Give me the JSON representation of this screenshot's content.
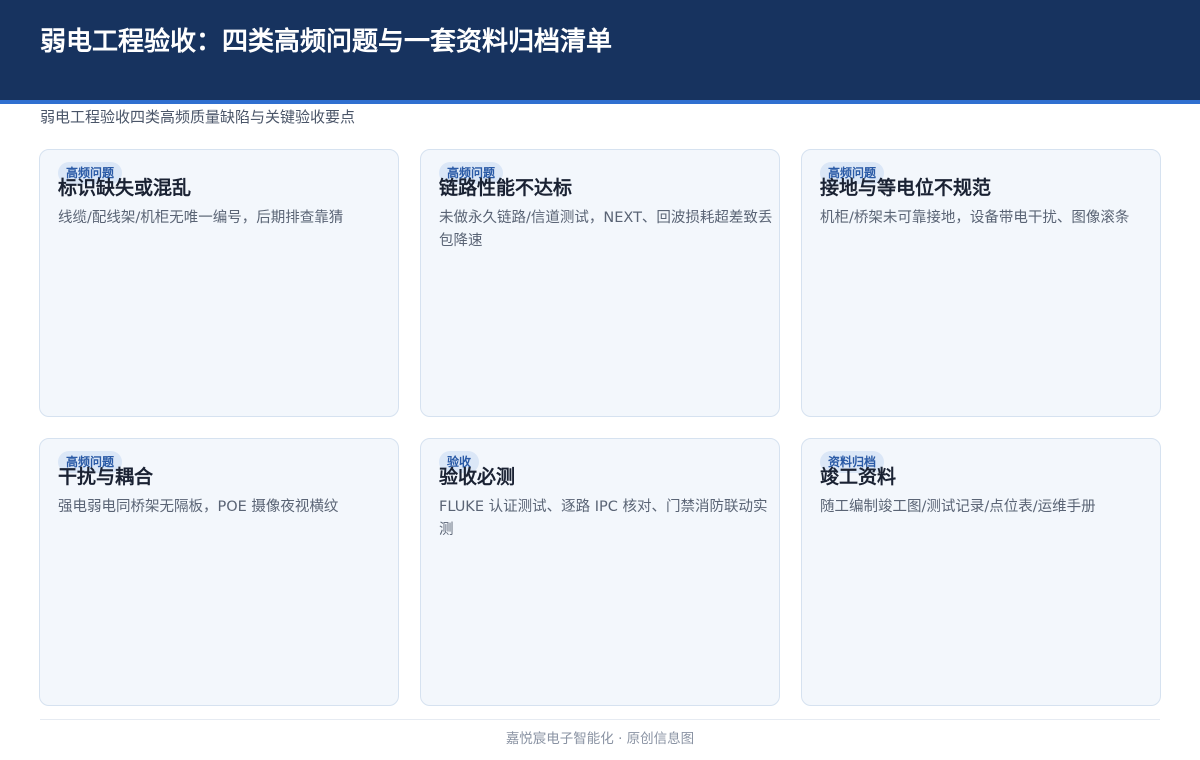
{
  "header": {
    "title": "弱电工程验收：四类高频问题与一套资料归档清单",
    "subtitle": "弱电工程验收四类高频质量缺陷与关键验收要点",
    "color": "#17335f",
    "accent": "#2f6fd0"
  },
  "cards": [
    {
      "tag": "高频问题",
      "title": "标识缺失或混乱",
      "desc": "线缆/配线架/机柜无唯一编号，后期排查靠猜"
    },
    {
      "tag": "高频问题",
      "title": "链路性能不达标",
      "desc": "未做永久链路/信道测试，NEXT、回波损耗超差致丢包降速"
    },
    {
      "tag": "高频问题",
      "title": "接地与等电位不规范",
      "desc": "机柜/桥架未可靠接地，设备带电干扰、图像滚条"
    },
    {
      "tag": "高频问题",
      "title": "干扰与耦合",
      "desc": "强电弱电同桥架无隔板，POE 摄像夜视横纹"
    },
    {
      "tag": "验收",
      "title": "验收必测",
      "desc": "FLUKE 认证测试、逐路 IPC 核对、门禁消防联动实测"
    },
    {
      "tag": "资料归档",
      "title": "竣工资料",
      "desc": "随工编制竣工图/测试记录/点位表/运维手册"
    }
  ],
  "footer": {
    "text": "嘉悦宸电子智能化 · 原创信息图"
  }
}
